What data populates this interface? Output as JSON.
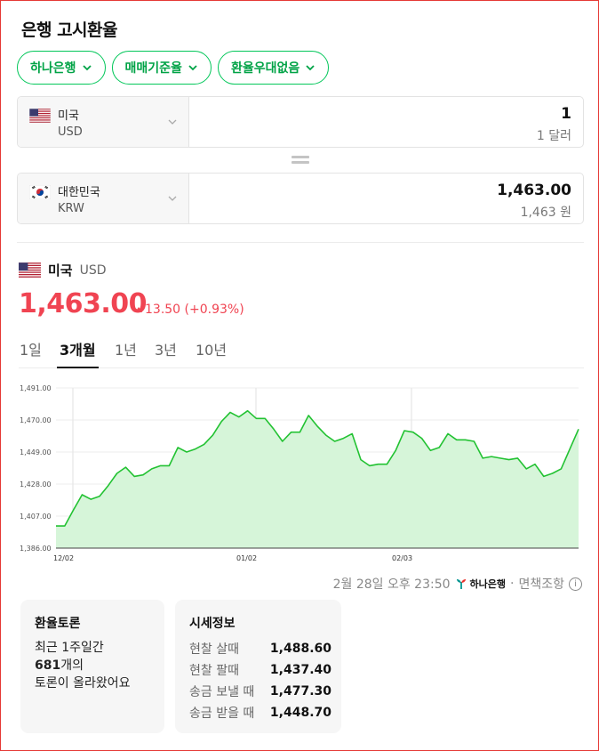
{
  "title": "은행 고시환율",
  "chips": [
    {
      "label": "하나은행"
    },
    {
      "label": "매매기준율"
    },
    {
      "label": "환율우대없음"
    }
  ],
  "converter": {
    "from": {
      "name": "미국",
      "code": "USD",
      "value": "1",
      "unit_text": "1 달러"
    },
    "to": {
      "name": "대한민국",
      "code": "KRW",
      "value": "1,463.00",
      "unit_text": "1,463 원"
    }
  },
  "currency": {
    "name": "미국",
    "code": "USD",
    "rate": "1,463.00",
    "change": "13.50 (+0.93%)",
    "change_direction": "up",
    "change_color": "#f04452"
  },
  "tabs": [
    {
      "label": "1일",
      "active": false
    },
    {
      "label": "3개월",
      "active": true
    },
    {
      "label": "1년",
      "active": false
    },
    {
      "label": "3년",
      "active": false
    },
    {
      "label": "10년",
      "active": false
    }
  ],
  "chart_data": {
    "type": "area",
    "title": "",
    "xlabel": "",
    "ylabel": "",
    "ylim": [
      1386,
      1491
    ],
    "yticks": [
      "1,491.00",
      "1,470.00",
      "1,449.00",
      "1,428.00",
      "1,407.00",
      "1,386.00"
    ],
    "xticks": [
      "12/02",
      "01/02",
      "02/03"
    ],
    "grid": true,
    "line_color": "#22c232",
    "fill_color": "#d6f5d9",
    "series": [
      {
        "values": [
          1400.5,
          1400.5,
          1411,
          1421,
          1418,
          1420,
          1427,
          1435,
          1439,
          1433,
          1434,
          1438,
          1440,
          1440,
          1452,
          1449,
          1451,
          1454,
          1460,
          1469,
          1475,
          1472,
          1476,
          1471,
          1471,
          1464,
          1456,
          1462,
          1462,
          1473,
          1466,
          1460,
          1456,
          1458,
          1461,
          1444,
          1440,
          1441,
          1441,
          1450,
          1463,
          1462,
          1458,
          1450,
          1452,
          1461,
          1457,
          1457,
          1456,
          1445,
          1446,
          1445,
          1444,
          1445,
          1438,
          1441,
          1433,
          1435,
          1438,
          1451,
          1464
        ]
      }
    ]
  },
  "updated": "2월 28일 오후 23:50",
  "bank_logo_text": "하나은행",
  "disclaimer": "면책조항",
  "forum": {
    "title": "환율토론",
    "line1": "최근 1주일간",
    "count": "681",
    "count_suffix": "개의",
    "line3": "토론이 올라왔어요"
  },
  "market_info": {
    "title": "시세정보",
    "rows": [
      {
        "label": "현찰 살때",
        "value": "1,488.60"
      },
      {
        "label": "현찰 팔때",
        "value": "1,437.40"
      },
      {
        "label": "송금 보낼 때",
        "value": "1,477.30"
      },
      {
        "label": "송금 받을 때",
        "value": "1,448.70"
      }
    ]
  }
}
